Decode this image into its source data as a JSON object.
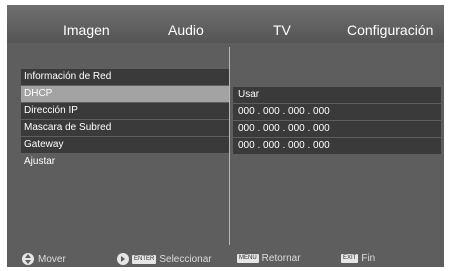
{
  "tabs": {
    "imagen": "Imagen",
    "audio": "Audio",
    "tv": "TV",
    "configuracion": "Configuración"
  },
  "left_menu": [
    "",
    "Información de Red",
    "DHCP",
    "Dirección IP",
    "Mascara de Subred",
    "Gateway",
    "Ajustar"
  ],
  "right_values": [
    "Usar",
    "000 . 000 . 000 . 000",
    "000 . 000 . 000 . 000",
    "000 . 000 . 000 . 000"
  ],
  "footer": {
    "move": "Mover",
    "enter_key": "ENTER",
    "select": "Seleccionar",
    "menu_key": "MENU",
    "return": "Retornar",
    "exit_key": "EXIT",
    "exit": "Fin"
  },
  "icons": {
    "move": "up-down-arrows-icon",
    "select": "right-arrow-icon"
  },
  "colors": {
    "background": "#5e5e5e",
    "row": "#3a3a3a",
    "selected_row": "#a3a3a3",
    "text": "#ffffff"
  }
}
